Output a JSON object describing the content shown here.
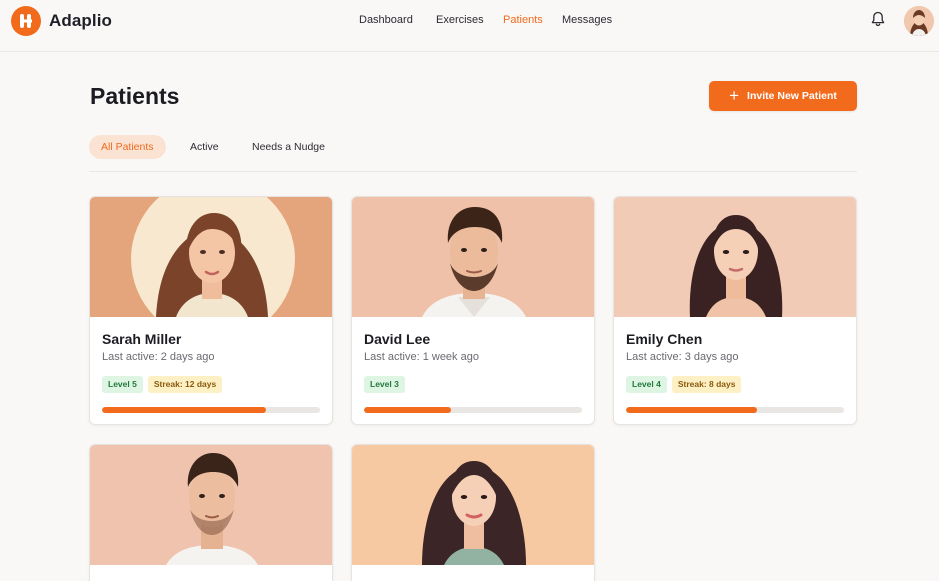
{
  "app": {
    "name": "Adaplio",
    "accent": "#f26b1d"
  },
  "nav": {
    "items": [
      {
        "label": "Dashboard",
        "active": false
      },
      {
        "label": "Exercises",
        "active": false
      },
      {
        "label": "Patients",
        "active": true
      },
      {
        "label": "Messages",
        "active": false
      }
    ]
  },
  "header_icons": {
    "notifications": "bell-icon",
    "profile": "user-avatar"
  },
  "page": {
    "title": "Patients",
    "invite_label": "Invite New Patient",
    "invite_icon": "plus-icon"
  },
  "tabs": [
    {
      "label": "All Patients",
      "active": true
    },
    {
      "label": "Active",
      "active": false
    },
    {
      "label": "Needs a Nudge",
      "active": false
    }
  ],
  "patients": [
    {
      "name": "Sarah Miller",
      "last_active": "Last active: 2 days ago",
      "level": "Level 5",
      "streak": "Streak: 12 days",
      "progress": 0.75
    },
    {
      "name": "David Lee",
      "last_active": "Last active: 1 week ago",
      "level": "Level 3",
      "streak": "",
      "progress": 0.4
    },
    {
      "name": "Emily Chen",
      "last_active": "Last active: 3 days ago",
      "level": "Level 4",
      "streak": "Streak: 8 days",
      "progress": 0.6
    },
    {
      "name": "",
      "last_active": "",
      "level": "",
      "streak": "",
      "progress": 0
    },
    {
      "name": "",
      "last_active": "",
      "level": "",
      "streak": "",
      "progress": 0
    }
  ]
}
